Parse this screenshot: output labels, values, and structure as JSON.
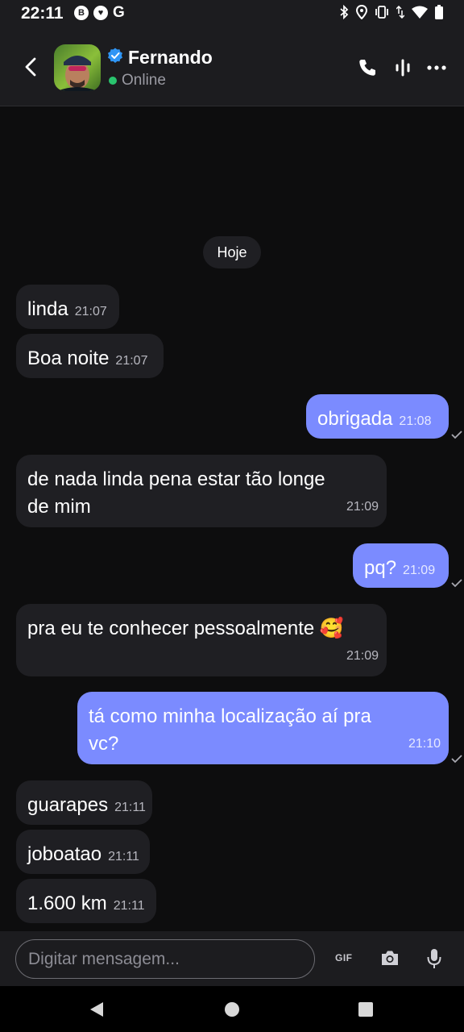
{
  "status_bar": {
    "time": "22:11",
    "left_icons": [
      "B",
      "G"
    ]
  },
  "header": {
    "name": "Fernando",
    "presence": "Online"
  },
  "date_separator": "Hoje",
  "messages": [
    {
      "text": "linda",
      "time": "21:07",
      "direction": "in"
    },
    {
      "text": "Boa noite",
      "time": "21:07",
      "direction": "in"
    },
    {
      "text": "obrigada",
      "time": "21:08",
      "direction": "out"
    },
    {
      "text": "de nada linda pena estar tão longe de mim",
      "time": "21:09",
      "direction": "in"
    },
    {
      "text": "pq?",
      "time": "21:09",
      "direction": "out"
    },
    {
      "text": "pra eu te conhecer pessoalmente 🥰",
      "time": "21:09",
      "direction": "in"
    },
    {
      "text": "tá como minha localização aí pra vc?",
      "time": "21:10",
      "direction": "out"
    },
    {
      "text": "guarapes",
      "time": "21:11",
      "direction": "in"
    },
    {
      "text": "joboatao",
      "time": "21:11",
      "direction": "in"
    },
    {
      "text": "1.600 km",
      "time": "21:11",
      "direction": "in"
    }
  ],
  "composer": {
    "placeholder": "Digitar mensagem...",
    "value": "",
    "gif_label": "GIF"
  },
  "colors": {
    "accent": "#7b8bff",
    "background": "#0d0d0e",
    "bubble_in": "#1f1f23",
    "online": "#29c46e"
  }
}
